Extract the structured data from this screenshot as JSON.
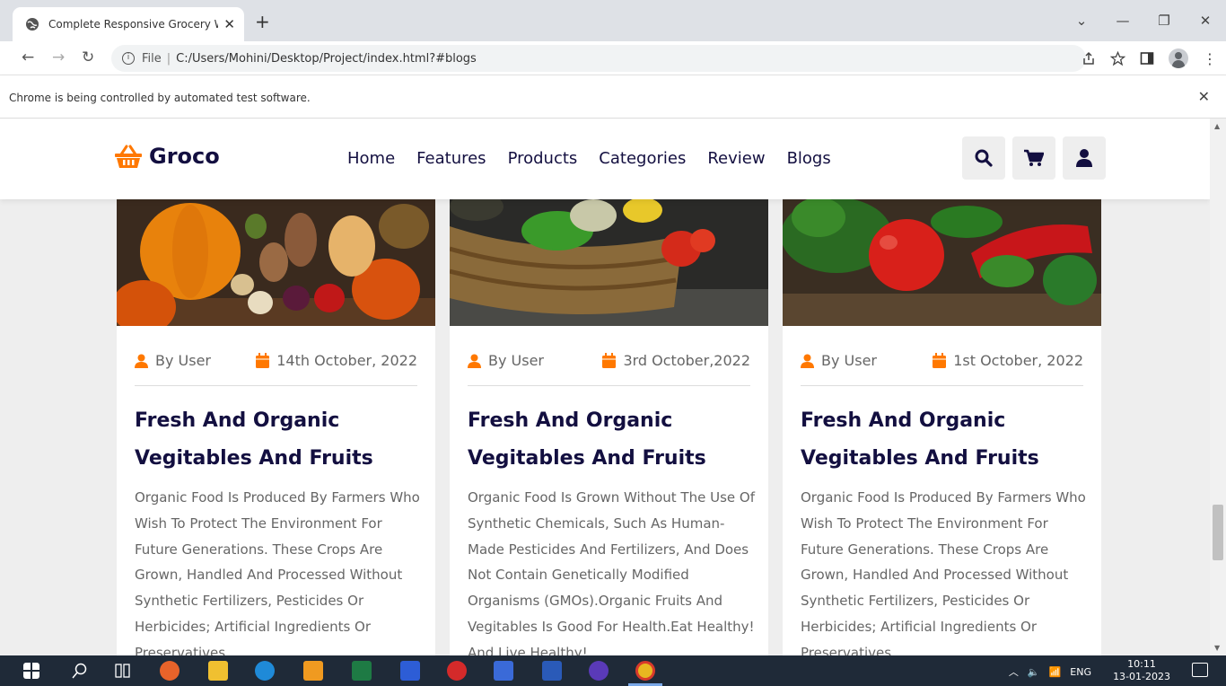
{
  "browser": {
    "tab_title": "Complete Responsive Grocery W",
    "tab_close": "✕",
    "new_tab": "+",
    "omnibox_scheme": "File",
    "omnibox_separator": "|",
    "url": "C:/Users/Mohini/Desktop/Project/index.html?#blogs",
    "infobar_message": "Chrome is being controlled by automated test software.",
    "infobar_close": "✕",
    "window_controls": [
      "⌄",
      "—",
      "❐",
      "✕"
    ]
  },
  "site": {
    "logo_text": "Groco",
    "nav": [
      "Home",
      "Features",
      "Products",
      "Categories",
      "Review",
      "Blogs"
    ],
    "accent_color": "#ff7800",
    "heading_color": "#130f40"
  },
  "blogs": [
    {
      "author": "By User",
      "date": "14th October, 2022",
      "title": "Fresh And Organic Vegitables And Fruits",
      "desc": "Organic Food Is Produced By Farmers Who Wish To Protect The Environment For Future Generations. These Crops Are Grown, Handled And Processed Without Synthetic Fertilizers, Pesticides Or Herbicides; Artificial Ingredients Or Preservatives"
    },
    {
      "author": "By User",
      "date": "3rd October,2022",
      "title": "Fresh And Organic Vegitables And Fruits",
      "desc": "Organic Food Is Grown Without The Use Of Synthetic Chemicals, Such As Human-Made Pesticides And Fertilizers, And Does Not Contain Genetically Modified Organisms (GMOs).Organic Fruits And Vegitables Is Good For Health.Eat Healthy! And Live Healthy!"
    },
    {
      "author": "By User",
      "date": "1st October, 2022",
      "title": "Fresh And Organic Vegitables And Fruits",
      "desc": "Organic Food Is Produced By Farmers Who Wish To Protect The Environment For Future Generations. These Crops Are Grown, Handled And Processed Without Synthetic Fertilizers, Pesticides Or Herbicides; Artificial Ingredients Or Preservatives"
    }
  ],
  "taskbar": {
    "language": "ENG",
    "time": "10:11",
    "date": "13-01-2023"
  }
}
